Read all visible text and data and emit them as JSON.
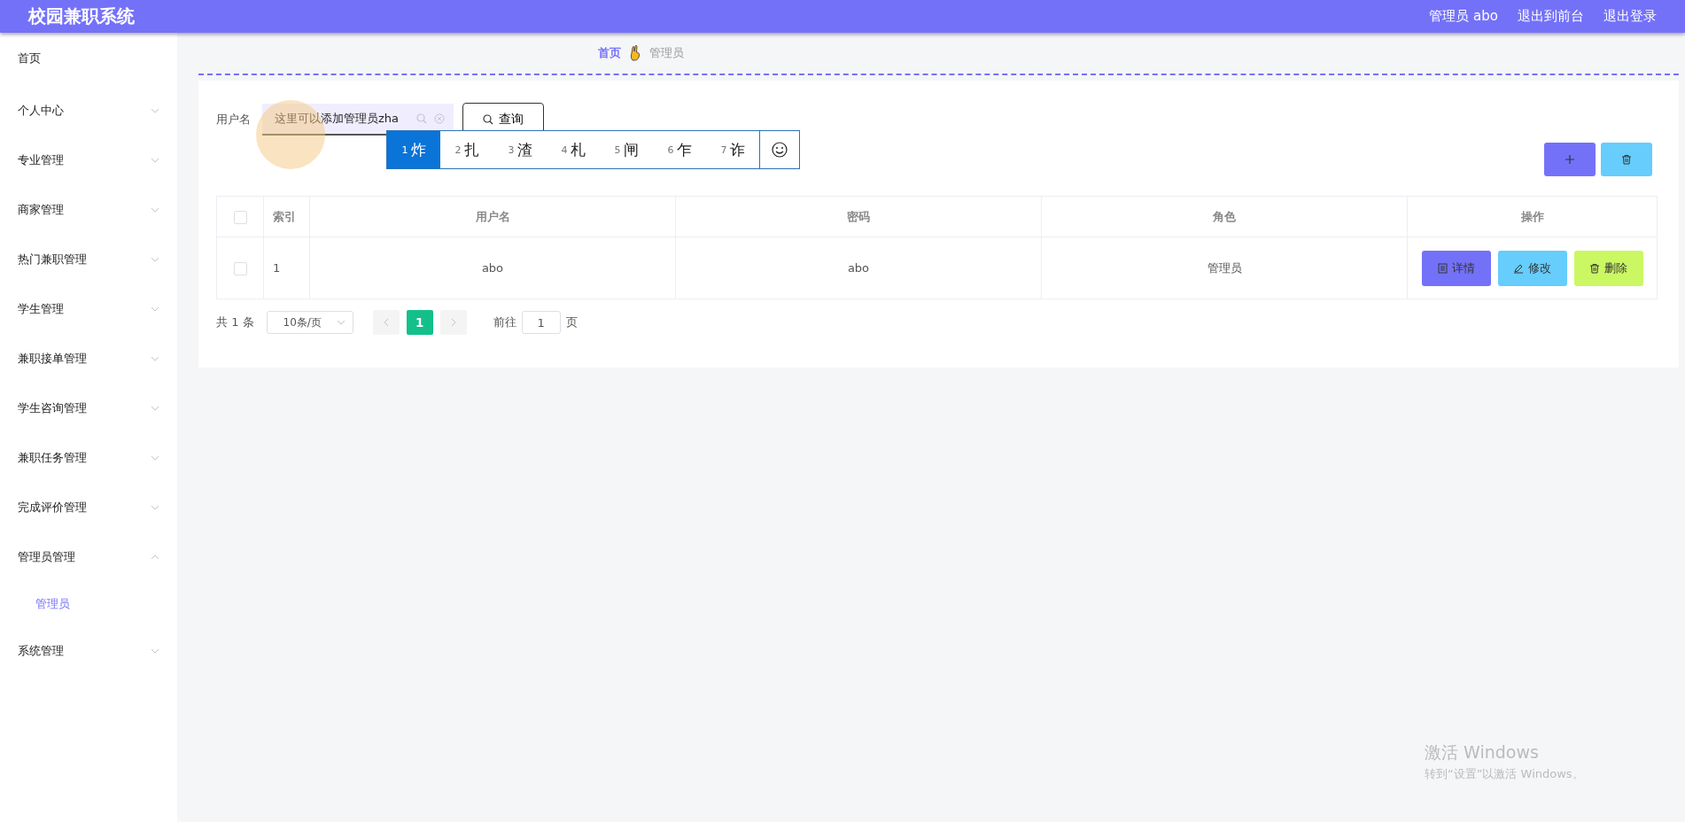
{
  "header": {
    "title": "校园兼职系统",
    "user": "管理员 abo",
    "links": [
      "退出到前台",
      "退出登录"
    ]
  },
  "sidebar": {
    "items": [
      {
        "label": "首页",
        "has_children": false
      },
      {
        "label": "个人中心",
        "has_children": true,
        "expanded": false
      },
      {
        "label": "专业管理",
        "has_children": true,
        "expanded": false
      },
      {
        "label": "商家管理",
        "has_children": true,
        "expanded": false
      },
      {
        "label": "热门兼职管理",
        "has_children": true,
        "expanded": false
      },
      {
        "label": "学生管理",
        "has_children": true,
        "expanded": false
      },
      {
        "label": "兼职接单管理",
        "has_children": true,
        "expanded": false
      },
      {
        "label": "学生咨询管理",
        "has_children": true,
        "expanded": false
      },
      {
        "label": "兼职任务管理",
        "has_children": true,
        "expanded": false
      },
      {
        "label": "完成评价管理",
        "has_children": true,
        "expanded": false
      },
      {
        "label": "管理员管理",
        "has_children": true,
        "expanded": true,
        "children": [
          {
            "label": "管理员",
            "selected": true
          }
        ]
      },
      {
        "label": "系统管理",
        "has_children": true,
        "expanded": false
      }
    ]
  },
  "breadcrumb": [
    {
      "label": "首页",
      "current": false
    },
    {
      "label": "管理员",
      "current": true
    }
  ],
  "search": {
    "label": "用户名",
    "value": "这里可以添加管理员zha",
    "button": "查询"
  },
  "ime": {
    "candidates": [
      {
        "index": "1",
        "text": "炸",
        "selected": true
      },
      {
        "index": "2",
        "text": "扎",
        "selected": false
      },
      {
        "index": "3",
        "text": "渣",
        "selected": false
      },
      {
        "index": "4",
        "text": "札",
        "selected": false
      },
      {
        "index": "5",
        "text": "闸",
        "selected": false
      },
      {
        "index": "6",
        "text": "乍",
        "selected": false
      },
      {
        "index": "7",
        "text": "诈",
        "selected": false
      }
    ]
  },
  "table": {
    "all_checked": false,
    "columns": [
      "索引",
      "用户名",
      "密码",
      "角色",
      "操作"
    ],
    "rows": [
      {
        "checked": false,
        "cells": [
          "1",
          "abo",
          "abo",
          "管理员"
        ],
        "actions": [
          {
            "kind": "detail",
            "label": "详情"
          },
          {
            "kind": "edit",
            "label": "修改"
          },
          {
            "kind": "delete",
            "label": "删除"
          }
        ]
      }
    ]
  },
  "pagination": {
    "total": "共 1 条",
    "page_size": "10条/页",
    "pages": [
      {
        "label": "1",
        "selected": true
      }
    ],
    "goto_label": "前往",
    "goto_value": "1",
    "goto_suffix": "页"
  },
  "watermark_os": {
    "title": "激活 Windows",
    "subtitle": "转到“设置”以激活 Windows。"
  }
}
